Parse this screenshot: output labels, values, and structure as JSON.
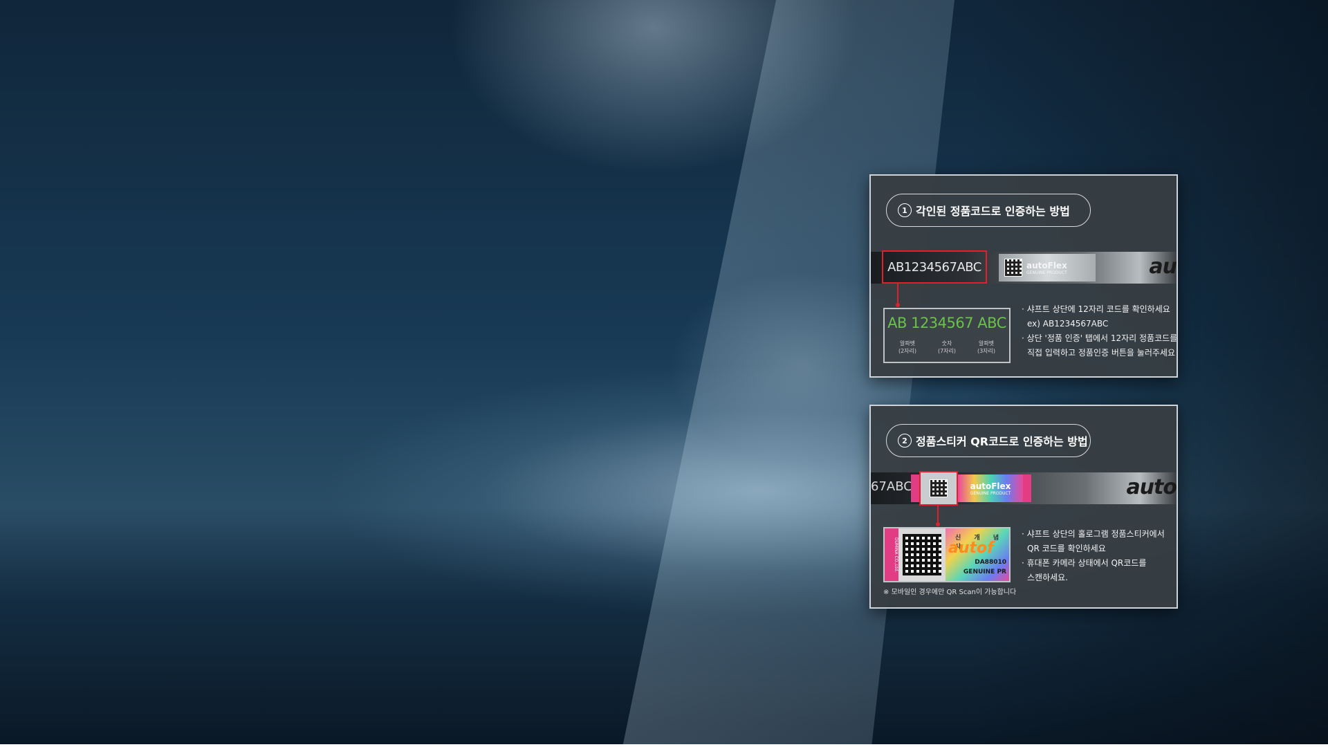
{
  "card1": {
    "number": "1",
    "title": "각인된 정품코드로 인증하는 방법",
    "shaft_code": "AB1234567ABC",
    "sticker_brand": "autoFlex",
    "sticker_label": "GENUINE PRODUCT",
    "strip_logo": "au",
    "zoom_code": "AB 1234567 ABC",
    "zoom_labels": [
      "알파벳\n(2자리)",
      "숫자\n(7자리)",
      "알파벳\n(3자리)"
    ],
    "bullets": [
      "· 샤프트 상단에 12자리 코드를 확인하세요",
      "  ex) AB1234567ABC",
      "· 상단 '정품 인증' 탭에서 12자리 정품코드를",
      "  직접 입력하고 정품인증 버튼을 눌러주세요"
    ]
  },
  "card2": {
    "number": "2",
    "title": "정품스티커 QR코드로 인증하는 방법",
    "strip_code_fragment": "67ABC",
    "strip_logo": "auto",
    "holo_brand": "autoFlex",
    "holo_label": "GENUINE PRODUCT",
    "zoom_text_top": "신 개 념 샤",
    "zoom_brand": "autof",
    "zoom_code": "DA88010",
    "zoom_genuine": "GENUINE PR",
    "zoom_pinkbar": "DUMINA CO.,Ltd.",
    "note": "※ 모바일인 경우에만 QR Scan이 가능합니다",
    "bullets": [
      "· 샤프트 상단의 홀로그램 정품스티커에서",
      "  QR 코드를 확인하세요",
      "· 휴대폰 카메라 상태에서 QR코드를",
      "  스캔하세요."
    ]
  },
  "colors": {
    "highlight_red": "#e0202a",
    "code_green": "#6cc14a",
    "card_bg": "#373e44"
  }
}
